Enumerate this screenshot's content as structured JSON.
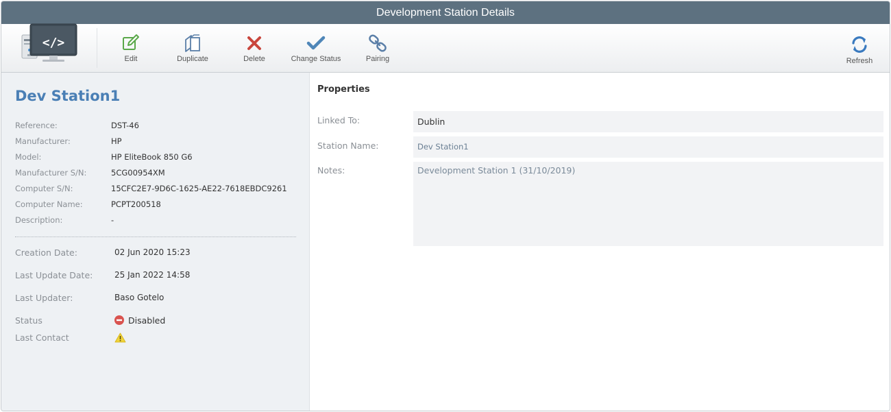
{
  "window": {
    "title": "Development Station Details"
  },
  "toolbar": {
    "app_icon": "computer-code-icon",
    "buttons": [
      {
        "label": "Edit",
        "icon": "edit-icon",
        "color": "#5aa84a"
      },
      {
        "label": "Duplicate",
        "icon": "duplicate-icon",
        "color": "#5b7fa8"
      },
      {
        "label": "Delete",
        "icon": "delete-icon",
        "color": "#c9463d"
      },
      {
        "label": "Change Status",
        "icon": "checkmark-icon",
        "color": "#4f86b8"
      },
      {
        "label": "Pairing",
        "icon": "link-icon",
        "color": "#5b7fa8"
      }
    ],
    "refresh": {
      "label": "Refresh",
      "icon": "refresh-icon",
      "color": "#3a7abf"
    }
  },
  "details": {
    "name": "Dev Station1",
    "info": [
      {
        "key": "Reference:",
        "value": "DST-46"
      },
      {
        "key": "Manufacturer:",
        "value": "HP"
      },
      {
        "key": "Model:",
        "value": "HP EliteBook 850 G6"
      },
      {
        "key": "Manufacturer S/N:",
        "value": "5CG00954XM"
      },
      {
        "key": "Computer S/N:",
        "value": "15CFC2E7-9D6C-1625-AE22-7618EBDC9261"
      },
      {
        "key": "Computer Name:",
        "value": "PCPT200518"
      },
      {
        "key": "Description:",
        "value": "-"
      }
    ],
    "meta": {
      "creation_date": {
        "key": "Creation Date:",
        "value": "02 Jun 2020 15:23"
      },
      "last_update_date": {
        "key": "Last Update Date:",
        "value": "25 Jan 2022 14:58"
      },
      "last_updater": {
        "key": "Last Updater:",
        "value": "Baso Gotelo"
      },
      "status": {
        "key": "Status",
        "value": "Disabled",
        "icon": "disabled-icon",
        "color": "#d9534f"
      },
      "last_contact": {
        "key": "Last Contact",
        "icon": "warning-icon",
        "color": "#f0d43a"
      }
    }
  },
  "properties": {
    "title": "Properties",
    "linked_to": {
      "label": "Linked To:",
      "value": "Dublin"
    },
    "station_name": {
      "label": "Station Name:",
      "value": "Dev Station1"
    },
    "notes": {
      "label": "Notes:",
      "value": "Development Station 1 (31/10/2019)"
    }
  }
}
